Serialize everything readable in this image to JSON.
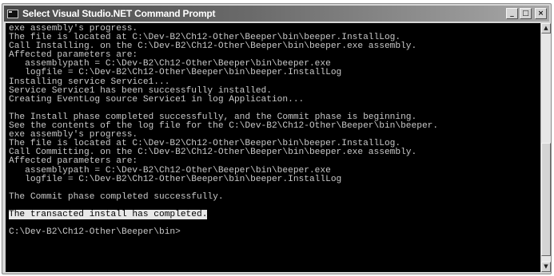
{
  "window": {
    "title": "Select Visual Studio.NET Command Prompt",
    "icon": "console-window-icon",
    "buttons": {
      "minimize": "_",
      "maximize": "□",
      "close": "×"
    }
  },
  "console": {
    "lines": [
      "exe assembly's progress.",
      "The file is located at C:\\Dev-B2\\Ch12-Other\\Beeper\\bin\\beeper.InstallLog.",
      "Call Installing. on the C:\\Dev-B2\\Ch12-Other\\Beeper\\bin\\beeper.exe assembly.",
      "Affected parameters are:",
      "   assemblypath = C:\\Dev-B2\\Ch12-Other\\Beeper\\bin\\beeper.exe",
      "   logfile = C:\\Dev-B2\\Ch12-Other\\Beeper\\bin\\beeper.InstallLog",
      "Installing service Service1...",
      "Service Service1 has been successfully installed.",
      "Creating EventLog source Service1 in log Application...",
      "",
      "The Install phase completed successfully, and the Commit phase is beginning.",
      "See the contents of the log file for the C:\\Dev-B2\\Ch12-Other\\Beeper\\bin\\beeper.",
      "exe assembly's progress.",
      "The file is located at C:\\Dev-B2\\Ch12-Other\\Beeper\\bin\\beeper.InstallLog.",
      "Call Committing. on the C:\\Dev-B2\\Ch12-Other\\Beeper\\bin\\beeper.exe assembly.",
      "Affected parameters are:",
      "   assemblypath = C:\\Dev-B2\\Ch12-Other\\Beeper\\bin\\beeper.exe",
      "   logfile = C:\\Dev-B2\\Ch12-Other\\Beeper\\bin\\beeper.InstallLog",
      "",
      "The Commit phase completed successfully.",
      "",
      "The transacted install has completed.",
      "",
      "C:\\Dev-B2\\Ch12-Other\\Beeper\\bin>"
    ],
    "highlighted_line_index": 21,
    "colors": {
      "background": "#000000",
      "text": "#c8c8c8",
      "highlight_background": "#e8e8e8",
      "highlight_text": "#000000"
    }
  },
  "scrollbar": {
    "up_arrow_icon": "scroll-up-arrow-icon",
    "down_arrow_icon": "scroll-down-arrow-icon"
  }
}
